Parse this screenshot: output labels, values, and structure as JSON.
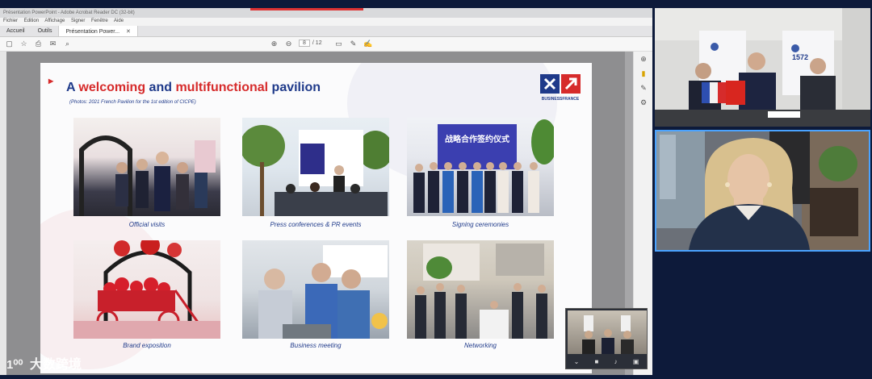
{
  "window": {
    "title": "Présentation PowerPoint - Adobe Acrobat Reader DC (32-bit)",
    "menu": [
      "Fichier",
      "Édition",
      "Affichage",
      "Signer",
      "Fenêtre",
      "Aide"
    ],
    "tabs": [
      {
        "label": "Accueil"
      },
      {
        "label": "Outils"
      },
      {
        "label": "Présentation Power..."
      }
    ],
    "toolbar": {
      "page_current": "8",
      "page_total": "/ 12"
    }
  },
  "slide": {
    "title": {
      "part1": "A ",
      "part2": "welcoming",
      "part3": " and ",
      "part4": "multifunctional",
      "part5": " pavilion"
    },
    "caption": "(Photos: 2021 French Pavilion for the 1st edition of CICPE)",
    "logo_text": "BUSINESSFRANCE",
    "photos": [
      {
        "label": "Official visits"
      },
      {
        "label": "Press conferences & PR events"
      },
      {
        "label": "Signing ceremonies"
      },
      {
        "label": "Brand exposition"
      },
      {
        "label": "Business meeting"
      },
      {
        "label": "Networking"
      }
    ],
    "sign_banner": "战略合作签约仪式"
  },
  "watermark": {
    "logo": "1⁰⁰",
    "text": "大数跨境"
  },
  "video_tiles": {
    "banner_number": "1572"
  },
  "colors": {
    "brand_blue": "#1f3a8a",
    "brand_red": "#d62b2b",
    "active_speaker": "#4aa3ff"
  }
}
